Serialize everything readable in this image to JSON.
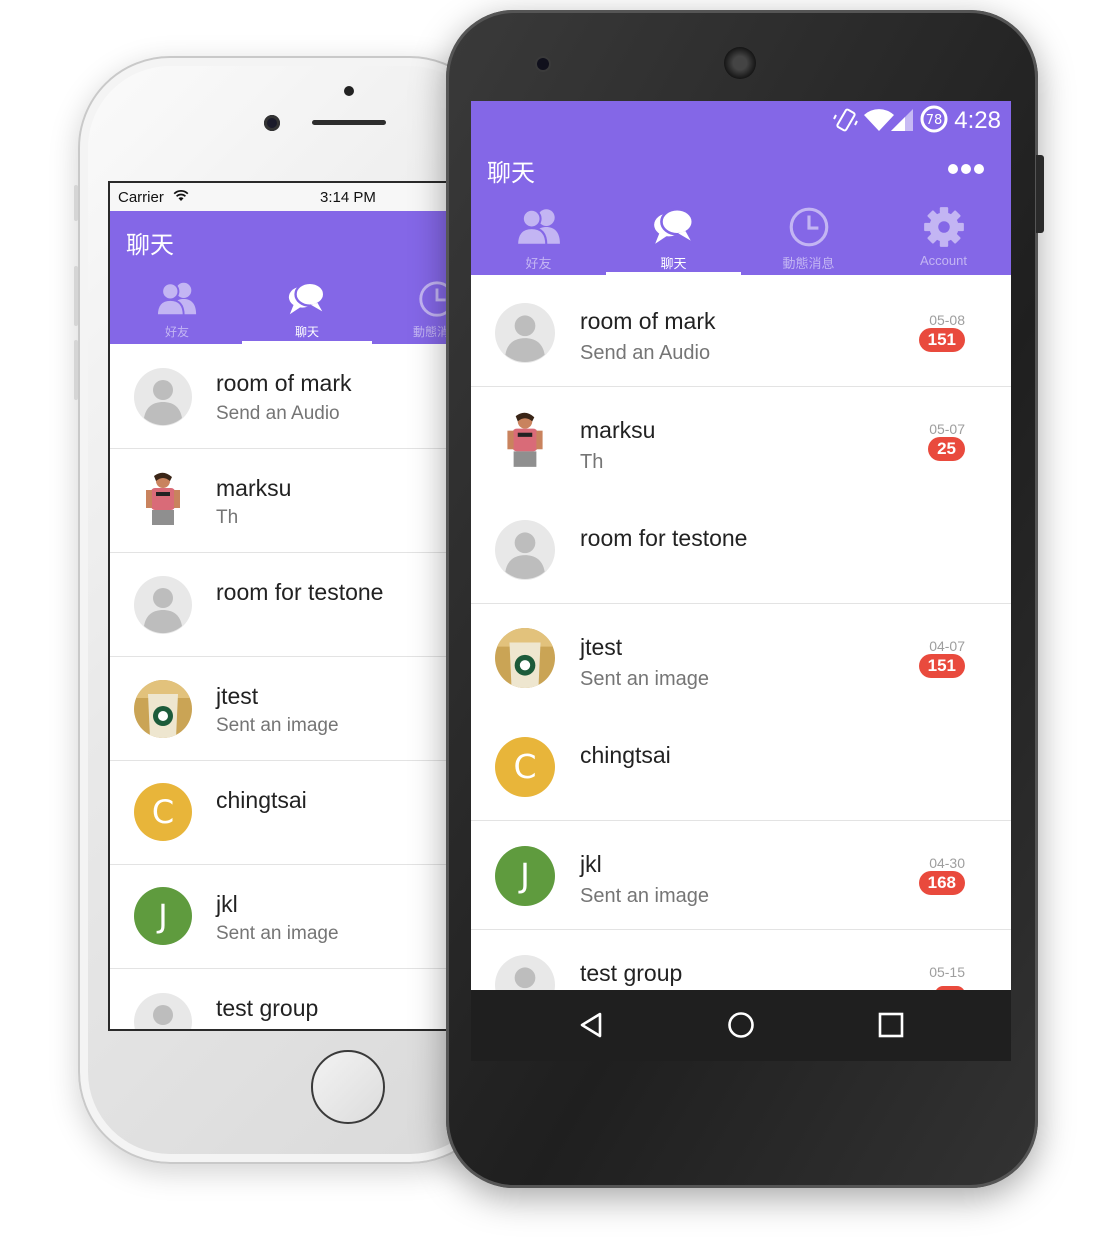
{
  "ios": {
    "status": {
      "carrier": "Carrier",
      "time": "3:14 PM"
    },
    "title": "聊天",
    "tabs": [
      {
        "label": "好友",
        "icon": "friends-icon",
        "active": false
      },
      {
        "label": "聊天",
        "icon": "chat-bubble-icon",
        "active": true
      },
      {
        "label": "動態消息",
        "icon": "clock-icon",
        "active": false
      }
    ],
    "conversations": [
      {
        "name": "room of mark",
        "subtitle": "Send an Audio",
        "avatar": "default-avatar"
      },
      {
        "name": "marksu",
        "subtitle": "Th",
        "avatar": "photo-avatar"
      },
      {
        "name": "room for testone",
        "subtitle": "",
        "avatar": "default-avatar"
      },
      {
        "name": "jtest",
        "subtitle": "Sent an image",
        "avatar": "photo-avatar"
      },
      {
        "name": "chingtsai",
        "subtitle": "",
        "avatar": "C",
        "color": "#e8b53a"
      },
      {
        "name": "jkl",
        "subtitle": "Sent an image",
        "avatar": "J",
        "color": "#5f9b3e"
      },
      {
        "name": "test group",
        "subtitle": "",
        "avatar": "default-avatar"
      }
    ]
  },
  "android": {
    "status": {
      "battery": "78",
      "time": "4:28"
    },
    "title": "聊天",
    "menu_icon": "more-dots-icon",
    "tabs": [
      {
        "label": "好友",
        "icon": "friends-icon",
        "active": false
      },
      {
        "label": "聊天",
        "icon": "chat-bubble-icon",
        "active": true
      },
      {
        "label": "動態消息",
        "icon": "clock-icon",
        "active": false
      },
      {
        "label": "Account",
        "icon": "gear-icon",
        "active": false
      }
    ],
    "conversations": [
      {
        "name": "room of mark",
        "subtitle": "Send an Audio",
        "date": "05-08",
        "badge": "151",
        "avatar": "default-avatar"
      },
      {
        "name": "marksu",
        "subtitle": "Th",
        "date": "05-07",
        "badge": "25",
        "avatar": "photo-avatar"
      },
      {
        "name": "room for testone",
        "subtitle": "",
        "date": "",
        "badge": "",
        "avatar": "default-avatar"
      },
      {
        "name": "jtest",
        "subtitle": "Sent an image",
        "date": "04-07",
        "badge": "151",
        "avatar": "photo-avatar"
      },
      {
        "name": "chingtsai",
        "subtitle": "",
        "date": "",
        "badge": "",
        "avatar": "C",
        "color": "#e8b53a"
      },
      {
        "name": "jkl",
        "subtitle": "Sent an image",
        "date": "04-30",
        "badge": "168",
        "avatar": "J",
        "color": "#5f9b3e"
      },
      {
        "name": "test group",
        "subtitle": "",
        "date": "05-15",
        "badge": "",
        "avatar": "default-avatar"
      }
    ],
    "nav": [
      {
        "name": "back-icon"
      },
      {
        "name": "home-icon"
      },
      {
        "name": "recents-icon"
      }
    ]
  },
  "colors": {
    "header": "#8467e7",
    "badge": "#e94a3d",
    "tab_inactive": "#c3b5f3"
  }
}
